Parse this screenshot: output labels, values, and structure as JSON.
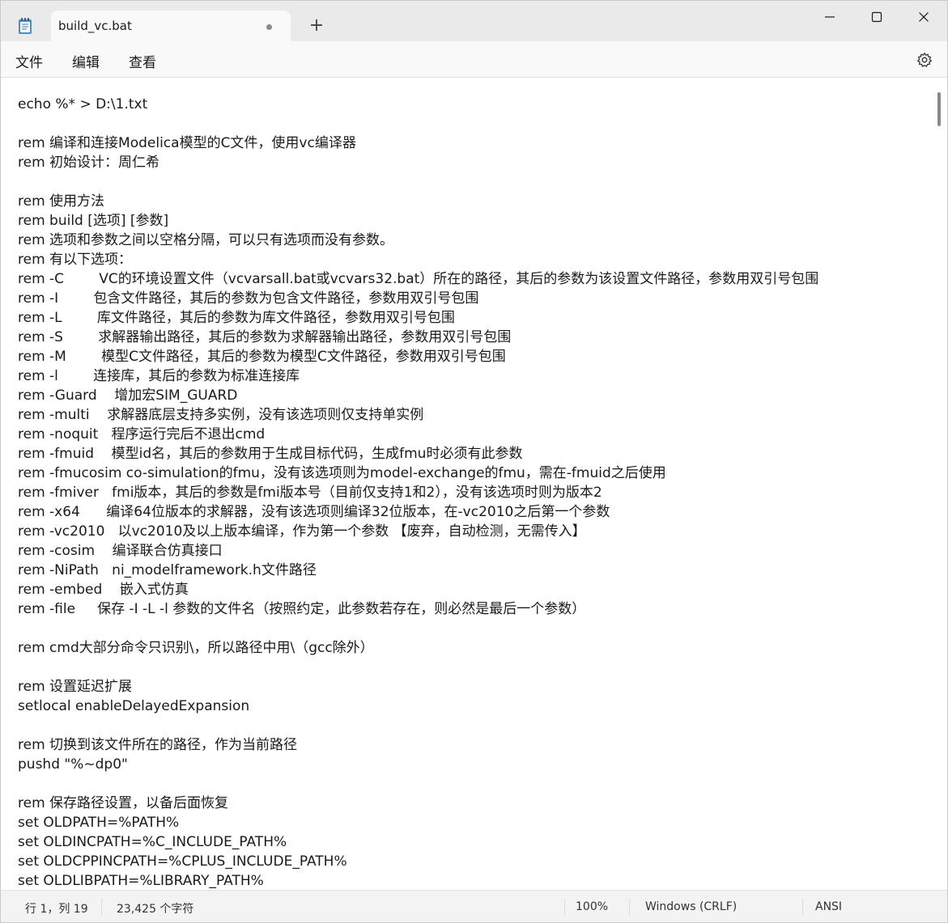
{
  "window": {
    "tab_title": "build_vc.bat",
    "new_tab_symbol": "+",
    "app_icon": "notepad-icon"
  },
  "menu": {
    "file": "文件",
    "edit": "编辑",
    "view": "查看",
    "settings_icon": "gear-icon"
  },
  "editor": {
    "lines": [
      "echo %* > D:\\1.txt",
      "",
      "rem 编译和连接Modelica模型的C文件，使用vc编译器",
      "rem 初始设计：周仁希",
      "",
      "rem 使用方法",
      "rem build [选项] [参数]",
      "rem 选项和参数之间以空格分隔，可以只有选项而没有参数。",
      "rem 有以下选项：",
      "rem -C        VC的环境设置文件（vcvarsall.bat或vcvars32.bat）所在的路径，其后的参数为该设置文件路径，参数用双引号包围",
      "rem -I        包含文件路径，其后的参数为包含文件路径，参数用双引号包围",
      "rem -L        库文件路径，其后的参数为库文件路径，参数用双引号包围",
      "rem -S        求解器输出路径，其后的参数为求解器输出路径，参数用双引号包围",
      "rem -M        模型C文件路径，其后的参数为模型C文件路径，参数用双引号包围",
      "rem -l        连接库，其后的参数为标准连接库",
      "rem -Guard    增加宏SIM_GUARD",
      "rem -multi    求解器底层支持多实例，没有该选项则仅支持单实例",
      "rem -noquit   程序运行完后不退出cmd",
      "rem -fmuid    模型id名，其后的参数用于生成目标代码，生成fmu时必须有此参数",
      "rem -fmucosim co-simulation的fmu，没有该选项则为model-exchange的fmu，需在-fmuid之后使用",
      "rem -fmiver   fmi版本，其后的参数是fmi版本号（目前仅支持1和2），没有该选项时则为版本2",
      "rem -x64      编译64位版本的求解器，没有该选项则编译32位版本，在-vc2010之后第一个参数",
      "rem -vc2010   以vc2010及以上版本编译，作为第一个参数 【废弃，自动检测，无需传入】",
      "rem -cosim    编译联合仿真接口",
      "rem -NiPath   ni_modelframework.h文件路径",
      "rem -embed    嵌入式仿真",
      "rem -file     保存 -I -L -l 参数的文件名（按照约定，此参数若存在，则必然是最后一个参数）",
      "",
      "rem cmd大部分命令只识别\\，所以路径中用\\（gcc除外）",
      "",
      "rem 设置延迟扩展",
      "setlocal enableDelayedExpansion",
      "",
      "rem 切换到该文件所在的路径，作为当前路径",
      "pushd \"%~dp0\"",
      "",
      "rem 保存路径设置，以备后面恢复",
      "set OLDPATH=%PATH%",
      "set OLDINCPATH=%C_INCLUDE_PATH%",
      "set OLDCPPINCPATH=%CPLUS_INCLUDE_PATH%",
      "set OLDLIBPATH=%LIBRARY_PATH%"
    ]
  },
  "status": {
    "position": "行 1，列 19",
    "char_count": "23,425 个字符",
    "zoom": "100%",
    "line_ending": "Windows (CRLF)",
    "encoding": "ANSI"
  }
}
